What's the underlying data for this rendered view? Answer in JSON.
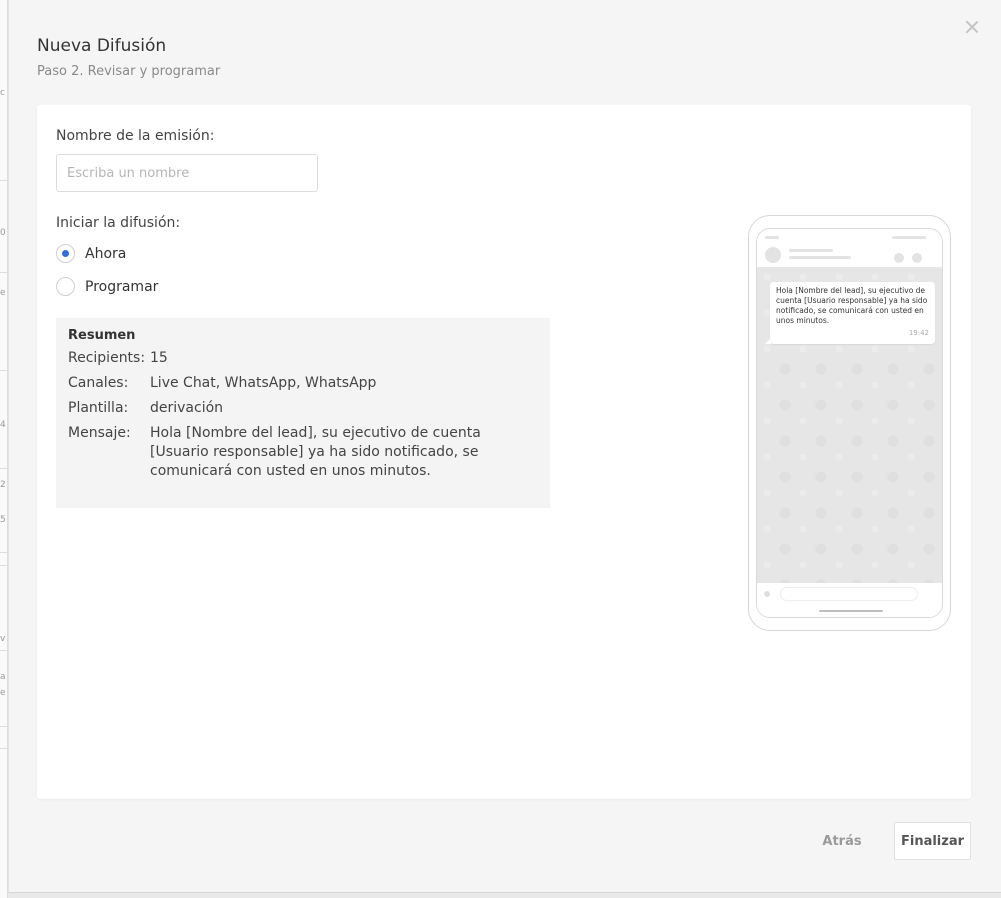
{
  "background_fragments": [
    "c",
    "0",
    "e",
    "4",
    "2",
    "5",
    "v",
    "a",
    "e"
  ],
  "dialog": {
    "title": "Nueva Difusión",
    "subtitle": "Paso 2. Revisar y programar"
  },
  "form": {
    "name_label": "Nombre de la emisión:",
    "name_placeholder": "Escriba un nombre",
    "name_value": "",
    "start_label": "Iniciar la difusión:",
    "start_options": [
      {
        "label": "Ahora",
        "selected": true
      },
      {
        "label": "Programar",
        "selected": false
      }
    ]
  },
  "summary": {
    "title": "Resumen",
    "rows": [
      {
        "key": "Recipients:",
        "value": "15"
      },
      {
        "key": "Canales:",
        "value": "Live Chat, WhatsApp, WhatsApp"
      },
      {
        "key": "Plantilla:",
        "value": "derivación"
      },
      {
        "key": "Mensaje:",
        "value": "Hola [Nombre del lead], su ejecutivo de cuenta [Usuario responsable] ya ha sido notificado, se comunicará con usted en unos minutos."
      }
    ]
  },
  "preview": {
    "message": "Hola [Nombre del lead], su ejecutivo de cuenta [Usuario responsable] ya ha sido notificado, se comunicará con usted en unos minutos.",
    "time": "19:42"
  },
  "footer": {
    "back_label": "Atrás",
    "finish_label": "Finalizar"
  },
  "colors": {
    "accent": "#2f6fe0",
    "modal_bg": "#f5f5f5",
    "card_bg": "#ffffff",
    "summary_bg": "#f4f4f4"
  }
}
